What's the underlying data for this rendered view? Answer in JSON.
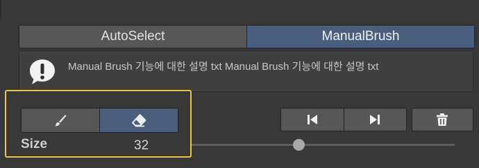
{
  "mode_tabs": [
    {
      "label": "AutoSelect",
      "active": false
    },
    {
      "label": "ManualBrush",
      "active": true
    }
  ],
  "help": {
    "icon": "exclamation-icon",
    "text": "Manual Brush 기능에 대한 설명 txt Manual Brush 기능에 대한 설명 txt"
  },
  "tools": [
    {
      "icon": "brush-icon",
      "active": false
    },
    {
      "icon": "eraser-icon",
      "active": true
    }
  ],
  "nav_buttons": [
    {
      "icon": "skip-previous-icon"
    },
    {
      "icon": "skip-next-icon"
    },
    {
      "icon": "trash-icon"
    }
  ],
  "size": {
    "label": "Size",
    "value": "32",
    "slider_fraction": 0.41
  },
  "colors": {
    "active": "#4a5f7d",
    "inactive": "#575757",
    "highlight": "#f1c63a",
    "background": "#383838"
  }
}
